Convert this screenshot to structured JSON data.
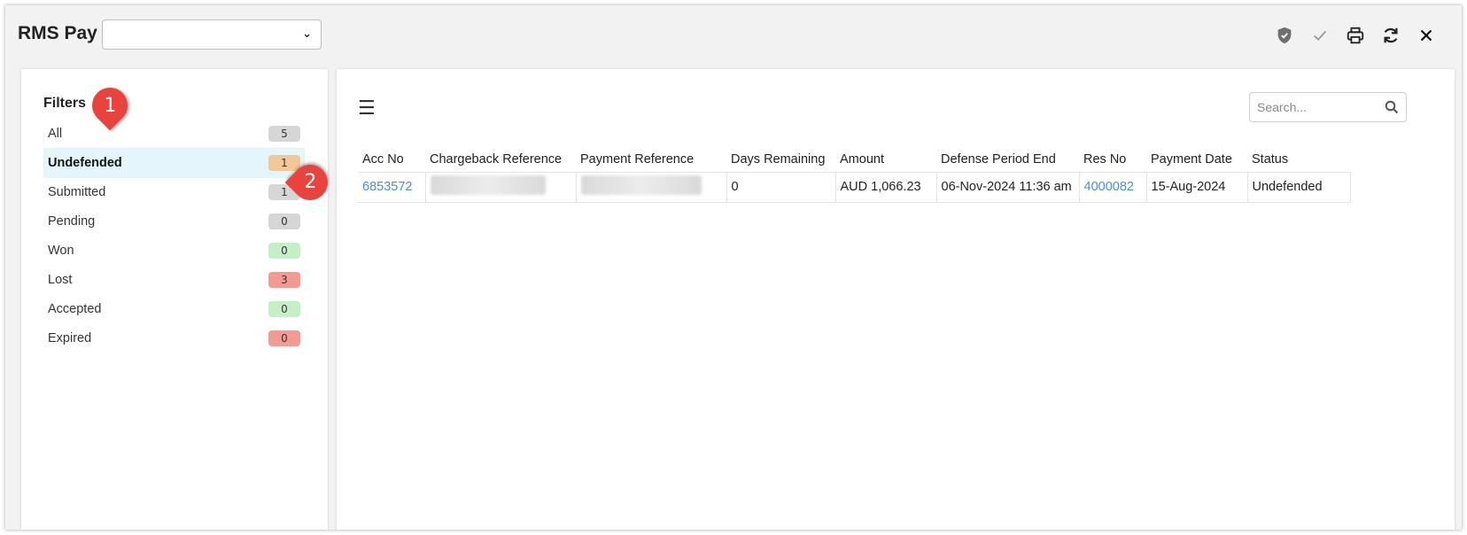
{
  "header": {
    "app_title": "RMS Pay",
    "selector_value": ""
  },
  "toolbar": {
    "icons": [
      "shield-check-icon",
      "check-icon",
      "printer-icon",
      "refresh-icon",
      "close-icon"
    ]
  },
  "filters": {
    "title": "Filters",
    "items": [
      {
        "label": "All",
        "count": "5",
        "badge_color": "#d6d6d6"
      },
      {
        "label": "Undefended",
        "count": "1",
        "badge_color": "#f2c79a",
        "active": true
      },
      {
        "label": "Submitted",
        "count": "1",
        "badge_color": "#d6d6d6"
      },
      {
        "label": "Pending",
        "count": "0",
        "badge_color": "#d6d6d6"
      },
      {
        "label": "Won",
        "count": "0",
        "badge_color": "#c5f0c5"
      },
      {
        "label": "Lost",
        "count": "3",
        "badge_color": "#f59a93"
      },
      {
        "label": "Accepted",
        "count": "0",
        "badge_color": "#c5f0c5"
      },
      {
        "label": "Expired",
        "count": "0",
        "badge_color": "#f59a93"
      }
    ]
  },
  "search": {
    "placeholder": "Search..."
  },
  "table": {
    "columns": [
      "Acc No",
      "Chargeback Reference",
      "Payment Reference",
      "Days Remaining",
      "Amount",
      "Defense Period End",
      "Res No",
      "Payment Date",
      "Status"
    ],
    "rows": [
      {
        "acc_no": "6853572",
        "chargeback_reference": "",
        "payment_reference": "",
        "days_remaining": "0",
        "amount": "AUD 1,066.23",
        "defense_period_end": "06-Nov-2024 11:36 am",
        "res_no": "4000082",
        "payment_date": "15-Aug-2024",
        "status": "Undefended"
      }
    ]
  },
  "callouts": [
    "1",
    "2"
  ],
  "colors": {
    "link": "#4a90c8",
    "active_row": "#e4f6fb",
    "callout": "#e8433c"
  }
}
